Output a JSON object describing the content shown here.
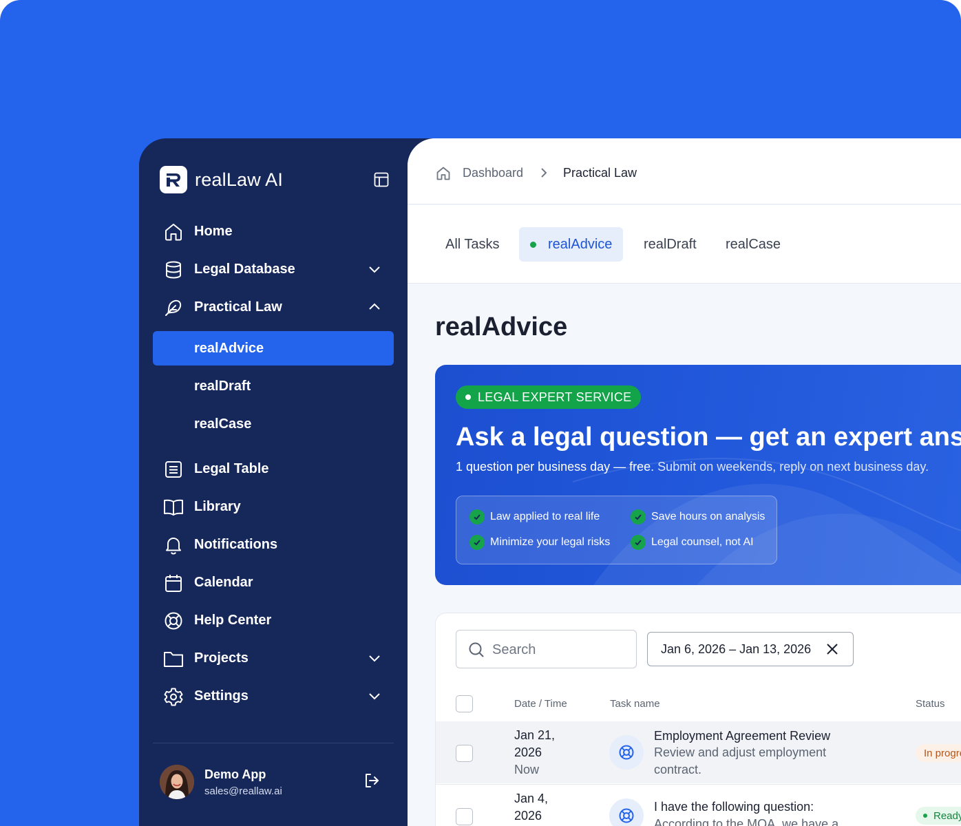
{
  "brand": {
    "name": "realLaw AI"
  },
  "sidebar": {
    "items": [
      {
        "label": "Home",
        "icon": "home-icon"
      },
      {
        "label": "Legal Database",
        "icon": "database-icon",
        "expandable": true,
        "expanded": false
      },
      {
        "label": "Practical Law",
        "icon": "feather-icon",
        "expandable": true,
        "expanded": true,
        "children": [
          {
            "label": "realAdvice",
            "active": true
          },
          {
            "label": "realDraft"
          },
          {
            "label": "realCase"
          }
        ]
      },
      {
        "label": "Legal Table",
        "icon": "table-icon"
      },
      {
        "label": "Library",
        "icon": "book-icon"
      },
      {
        "label": "Notifications",
        "icon": "bell-icon"
      },
      {
        "label": "Calendar",
        "icon": "calendar-icon"
      },
      {
        "label": "Help Center",
        "icon": "lifebuoy-icon"
      },
      {
        "label": "Projects",
        "icon": "folder-icon",
        "expandable": true,
        "expanded": false
      },
      {
        "label": "Settings",
        "icon": "gear-icon",
        "expandable": true,
        "expanded": false
      }
    ],
    "user": {
      "name": "Demo App",
      "email": "sales@reallaw.ai"
    }
  },
  "breadcrumb": {
    "items": [
      "Dashboard",
      "Practical Law"
    ]
  },
  "tabs": [
    {
      "label": "All Tasks"
    },
    {
      "label": "realAdvice",
      "active": true
    },
    {
      "label": "realDraft"
    },
    {
      "label": "realCase"
    }
  ],
  "page": {
    "title": "realAdvice"
  },
  "hero": {
    "badge": "LEGAL EXPERT SERVICE",
    "title": "Ask a legal question — get an expert answer",
    "subtitle_strong": "1 question per business day — free.",
    "subtitle_rest": " Submit on weekends, reply on next business day.",
    "features": [
      "Law applied to real life",
      "Save hours on analysis",
      "Minimize your legal risks",
      "Legal counsel, not AI"
    ]
  },
  "table": {
    "search_placeholder": "Search",
    "date_range": "Jan 6, 2026 – Jan 13, 2026",
    "columns": {
      "date": "Date / Time",
      "task": "Task name",
      "status": "Status"
    },
    "rows": [
      {
        "date_line1": "Jan 21,",
        "date_line2": "2026",
        "date_rel": "Now",
        "title": "Employment Agreement Review",
        "desc": "Review and adjust employment contract.",
        "status": "In progress"
      },
      {
        "date_line1": "Jan 4,",
        "date_line2": "2026",
        "date_rel": "",
        "title": "I have the following question:",
        "desc": "According to the MOA, we have a",
        "status": "Ready"
      }
    ]
  },
  "colors": {
    "brand_blue": "#2463EB",
    "sidebar_bg": "#16275A",
    "accent_green": "#17A34A"
  }
}
